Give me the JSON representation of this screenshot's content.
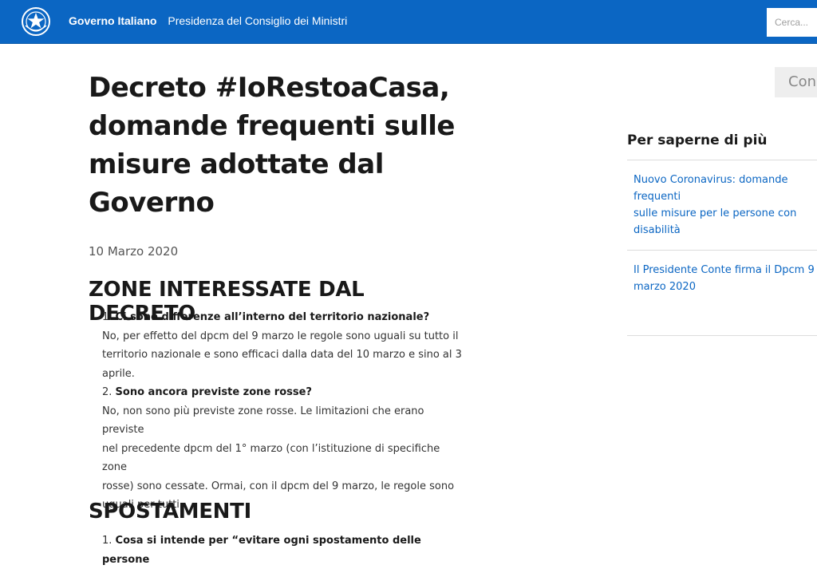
{
  "header": {
    "org_short": "Governo Italiano",
    "org_full": "Presidenza del Consiglio dei Ministri",
    "search_placeholder": "Cerca..."
  },
  "article": {
    "title_lines": [
      "Decreto #IoRestoaCasa,",
      "domande frequenti sulle",
      "misure adottate dal",
      "Governo"
    ],
    "date": "10 Marzo 2020",
    "sections": [
      {
        "heading": "ZONE INTERESSATE DAL DECRETO",
        "items": [
          {
            "num": "1.",
            "question": "Ci sono differenze all’interno del territorio nazionale?",
            "answer_lines": [
              "No, per effetto del dpcm del 9 marzo le regole sono uguali su tutto il",
              "territorio nazionale e sono efficaci dalla data del 10 marzo e sino al 3",
              "aprile."
            ]
          },
          {
            "num": "2.",
            "question": "Sono ancora previste zone rosse?",
            "answer_lines": [
              "No, non sono più previste zone rosse. Le limitazioni che erano previste",
              "nel precedente dpcm del 1° marzo (con l’istituzione di specifiche zone",
              "rosse) sono cessate. Ormai, con il dpcm del 9 marzo, le regole sono",
              "uguali per tutti."
            ]
          }
        ]
      },
      {
        "heading": "SPOSTAMENTI",
        "items": [
          {
            "num": "1.",
            "question": "Cosa si intende per “evitare ogni spostamento delle persone"
          }
        ]
      }
    ]
  },
  "sidebar": {
    "share_label": "Condividi",
    "title": "Per saperne di più",
    "links": [
      [
        "Nuovo Coronavirus: domande frequenti",
        "sulle misure per le persone con",
        "disabilità"
      ],
      [
        "Il Presidente Conte firma il Dpcm 9",
        "marzo 2020"
      ]
    ]
  },
  "colors": {
    "header_blue": "#0b66c3",
    "link_blue": "#0b66c3"
  },
  "icons": {
    "emblem": "italian-republic-emblem-icon"
  }
}
